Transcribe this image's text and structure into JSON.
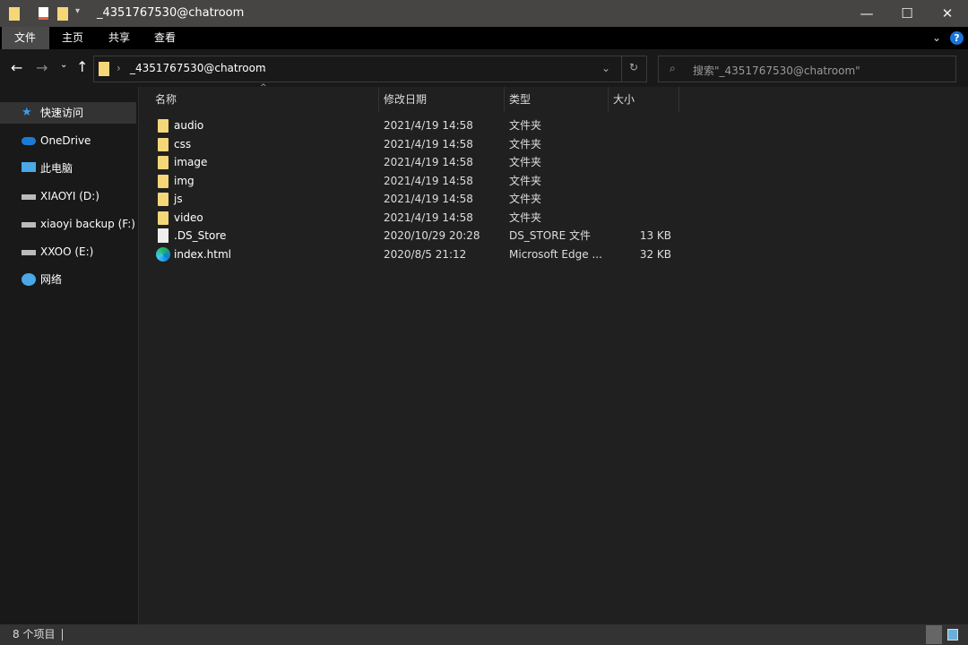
{
  "window": {
    "title": "_4351767530@chatroom",
    "minimize": "—",
    "maximize": "☐",
    "close": "✕"
  },
  "ribbon": {
    "tabs": [
      "文件",
      "主页",
      "共享",
      "查看"
    ],
    "help": "?"
  },
  "address": {
    "path": "_4351767530@chatroom",
    "search_placeholder": "搜索\"_4351767530@chatroom\""
  },
  "sidebar": {
    "items": [
      {
        "label": "快速访问",
        "icon": "star-icon"
      },
      {
        "label": "OneDrive",
        "icon": "cloud-icon"
      },
      {
        "label": "此电脑",
        "icon": "computer-icon"
      },
      {
        "label": "XIAOYI (D:)",
        "icon": "drive-icon"
      },
      {
        "label": "xiaoyi backup (F:)",
        "icon": "drive-icon"
      },
      {
        "label": "XXOO (E:)",
        "icon": "drive-icon"
      },
      {
        "label": "网络",
        "icon": "network-icon"
      }
    ]
  },
  "columns": {
    "name": "名称",
    "date": "修改日期",
    "type": "类型",
    "size": "大小"
  },
  "files": [
    {
      "name": "audio",
      "date": "2021/4/19 14:58",
      "type": "文件夹",
      "size": "",
      "icon": "folder"
    },
    {
      "name": "css",
      "date": "2021/4/19 14:58",
      "type": "文件夹",
      "size": "",
      "icon": "folder"
    },
    {
      "name": "image",
      "date": "2021/4/19 14:58",
      "type": "文件夹",
      "size": "",
      "icon": "folder"
    },
    {
      "name": "img",
      "date": "2021/4/19 14:58",
      "type": "文件夹",
      "size": "",
      "icon": "folder"
    },
    {
      "name": "js",
      "date": "2021/4/19 14:58",
      "type": "文件夹",
      "size": "",
      "icon": "folder"
    },
    {
      "name": "video",
      "date": "2021/4/19 14:58",
      "type": "文件夹",
      "size": "",
      "icon": "folder"
    },
    {
      "name": ".DS_Store",
      "date": "2020/10/29 20:28",
      "type": "DS_STORE 文件",
      "size": "13 KB",
      "icon": "file"
    },
    {
      "name": "index.html",
      "date": "2020/8/5 21:12",
      "type": "Microsoft Edge ...",
      "size": "32 KB",
      "icon": "edge"
    }
  ],
  "status": {
    "count": "8 个项目"
  }
}
